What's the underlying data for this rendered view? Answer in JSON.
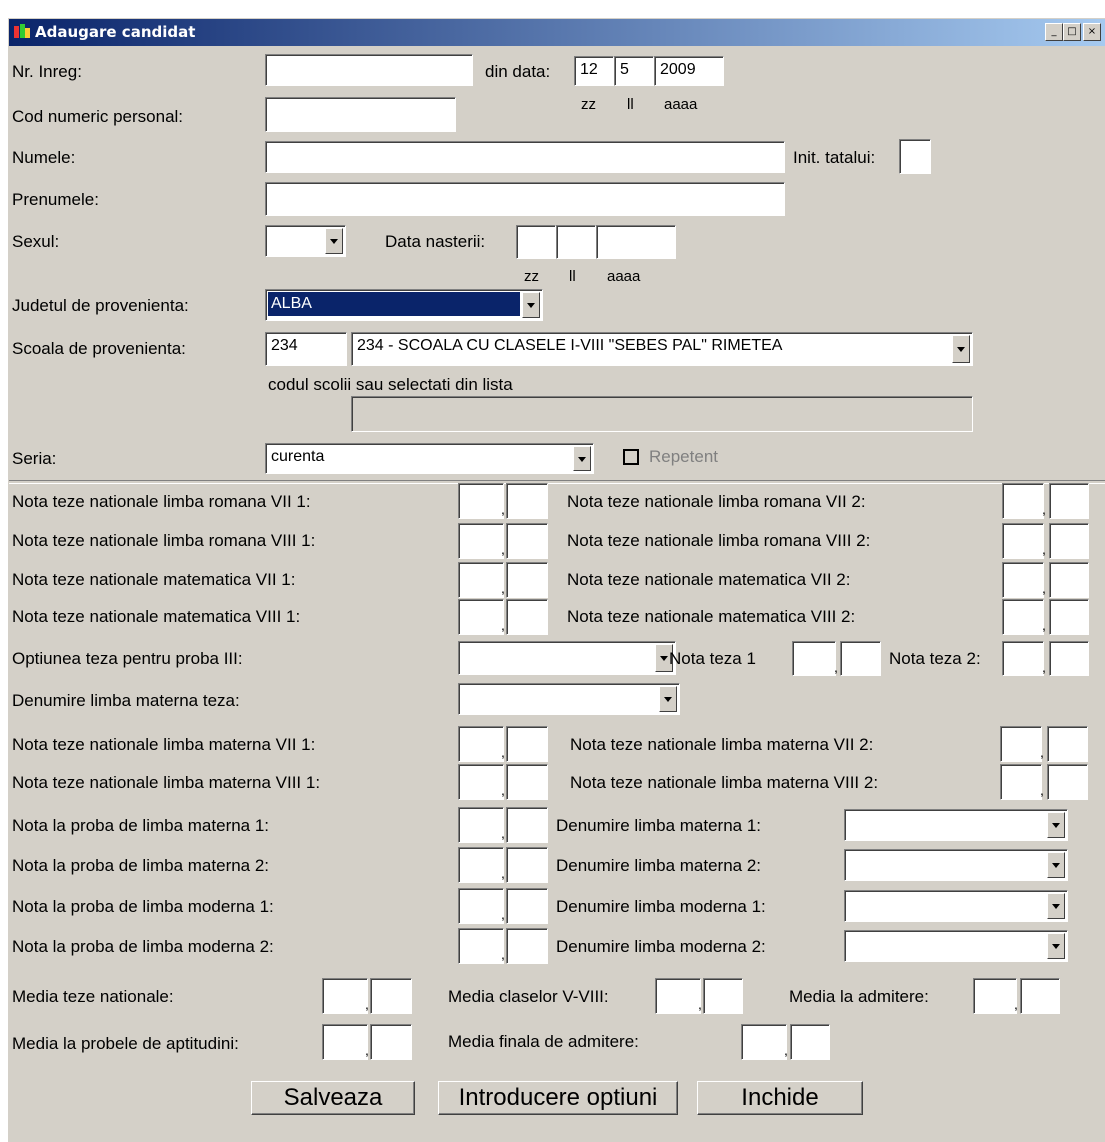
{
  "window": {
    "title": "Adaugare candidat",
    "minimize": "_",
    "maximize": "□",
    "close": "×"
  },
  "header": {
    "nr_inreg_label": "Nr. Inreg:",
    "nr_inreg_value": "",
    "din_data_label": "din data:",
    "date_day": "12",
    "date_month": "5",
    "date_year": "2009",
    "date_hint_zz": "zz",
    "date_hint_ll": "ll",
    "date_hint_aaaa": "aaaa",
    "cnp_label": "Cod numeric personal:",
    "cnp_value": "",
    "numele_label": "Numele:",
    "numele_value": "",
    "init_tatalui_label": "Init. tatalui:",
    "init_tatalui_value": "",
    "prenumele_label": "Prenumele:",
    "prenumele_value": "",
    "sexul_label": "Sexul:",
    "sexul_value": "",
    "data_nasterii_label": "Data nasterii:",
    "dn_day": "",
    "dn_month": "",
    "dn_year": "",
    "dn_hint_zz": "zz",
    "dn_hint_ll": "ll",
    "dn_hint_aaaa": "aaaa",
    "judet_label": "Judetul de provenienta:",
    "judet_value": "ALBA",
    "scoala_label": "Scoala de provenienta:",
    "scoala_code": "234",
    "scoala_value": "234  - SCOALA CU CLASELE I-VIII \"SEBES PAL\" RIMETEA",
    "scoala_hint": "codul scolii sau selectati din lista",
    "scoala_extra": "",
    "seria_label": "Seria:",
    "seria_value": "curenta",
    "repetent_label": "Repetent"
  },
  "grades": {
    "r1_left": "Nota teze nationale limba romana VII 1:",
    "r1_right": "Nota teze nationale limba romana VII 2:",
    "r2_left": "Nota teze nationale limba romana VIII 1:",
    "r2_right": "Nota teze nationale limba romana VIII 2:",
    "r3_left": "Nota teze nationale matematica VII 1:",
    "r3_right": "Nota teze nationale matematica VII 2:",
    "r4_left": "Nota teze nationale matematica VIII 1:",
    "r4_right": "Nota teze nationale matematica VIII 2:",
    "optiunea_label": "Optiunea teza pentru proba III:",
    "optiunea_value": "",
    "nota_teza1_label": "Nota teza 1",
    "nota_teza2_label": "Nota teza 2:",
    "denumire_lm_teza_label": "Denumire limba materna teza:",
    "denumire_lm_teza_value": "",
    "r5_left": "Nota teze nationale limba materna VII 1:",
    "r5_right": "Nota teze nationale limba materna VII 2:",
    "r6_left": "Nota teze nationale limba materna VIII 1:",
    "r6_right": "Nota teze nationale limba materna VIII 2:",
    "p1_left": "Nota la proba de limba materna 1:",
    "p1_right": "Denumire limba materna 1:",
    "p2_left": "Nota la proba de limba materna 2:",
    "p2_right": "Denumire limba materna 2:",
    "p3_left": "Nota la proba de limba moderna 1:",
    "p3_right": "Denumire limba moderna 1:",
    "p4_left": "Nota la proba de limba moderna 2:",
    "p4_right": "Denumire limba moderna 2:",
    "decimal_sep": ","
  },
  "averages": {
    "media_teze_label": "Media teze nationale:",
    "media_clase_label": "Media claselor V-VIII:",
    "media_admitere_label": "Media la admitere:",
    "media_aptitudini_label": "Media la probele de aptitudini:",
    "media_finala_label": "Media finala de admitere:"
  },
  "buttons": {
    "save": "Salveaza",
    "options": "Introducere optiuni",
    "close": "Inchide"
  }
}
